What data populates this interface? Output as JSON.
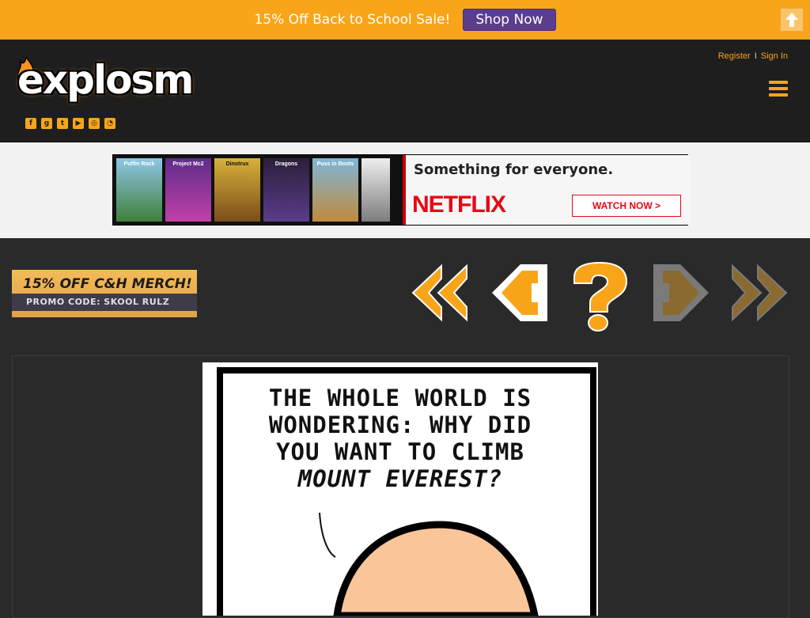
{
  "promo": {
    "text": "15% Off Back to School Sale!",
    "button": "Shop Now"
  },
  "header": {
    "logo": "explosm",
    "register": "Register",
    "separator": "I",
    "signin": "Sign In",
    "social_icons": [
      "facebook-icon",
      "google-plus-icon",
      "twitter-icon",
      "youtube-icon",
      "instagram-icon",
      "rss-icon"
    ]
  },
  "ad": {
    "thumbs": [
      "Puffin Rock",
      "Project Mc2",
      "Dinotrux",
      "Dragons",
      "Puss in Boots",
      ""
    ],
    "headline": "Something for everyone.",
    "brand": "NETFLIX",
    "cta": "WATCH NOW >"
  },
  "merch": {
    "top": "15% OFF C&H MERCH!",
    "bottom": "PROMO CODE: SKOOL RULZ"
  },
  "comic": {
    "lines": [
      "THE WHOLE WORLD IS",
      "WONDERING: WHY DID",
      "YOU WANT TO CLIMB",
      "MOUNT EVEREST?"
    ]
  },
  "colors": {
    "accent": "#f9a51a",
    "header_bg": "#1e1e1e",
    "page_bg": "#2a2a2a",
    "shop_btn": "#5a3d8e"
  }
}
